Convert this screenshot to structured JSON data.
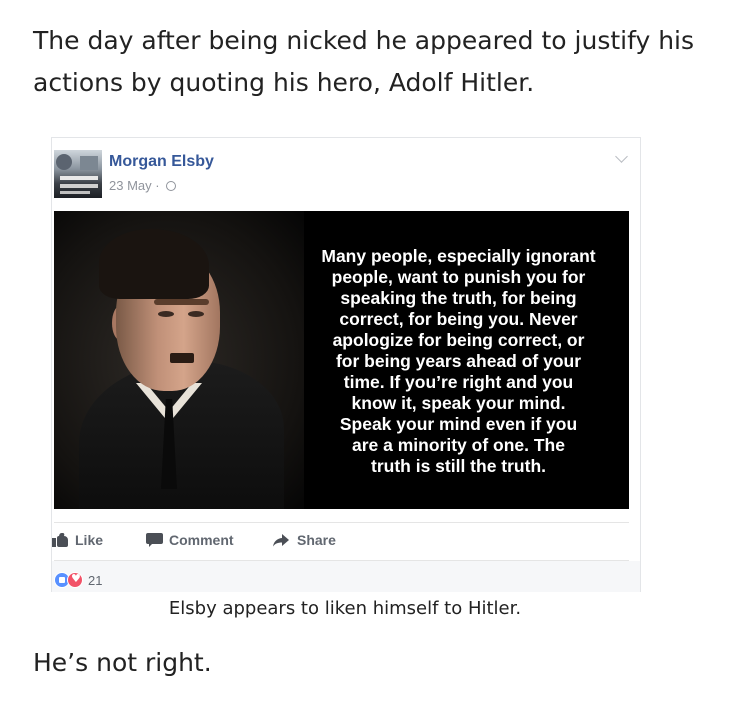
{
  "article": {
    "intro_text": "The day after being nicked he appeared to justify his actions by quoting his hero, Adolf Hitler.",
    "caption": "Elsby appears to liken himself to Hitler.",
    "outro_text": "He’s not right."
  },
  "post": {
    "poster_name": "Morgan Elsby",
    "date": "23 May · ",
    "privacy_icon": "globe-icon",
    "quote": "Many people, especially ignorant\npeople, want to punish you for\nspeaking the truth, for being\ncorrect, for being you. Never\napologize for being correct, or\nfor being years ahead of your\ntime. If you’re right and you\nknow it, speak your mind.\nSpeak your mind even if you\nare a minority of one. The\ntruth is still the truth.",
    "actions": {
      "like_label": "Like",
      "comment_label": "Comment",
      "share_label": "Share"
    },
    "reactions": {
      "count": "21",
      "icons": [
        "like-reaction-icon",
        "love-reaction-icon"
      ]
    }
  },
  "colors": {
    "link_blue": "#365899",
    "meta_gray": "#90949c",
    "action_gray": "#616770",
    "like_blue": "#5890ff",
    "love_red": "#f25268"
  }
}
